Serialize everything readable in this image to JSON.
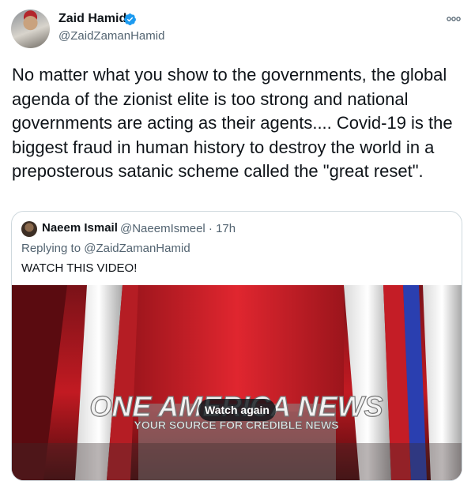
{
  "author": {
    "name": "Zaid Hamid",
    "handle": "@ZaidZamanHamid",
    "verified": true,
    "avatar_icon": "profile-photo"
  },
  "tweet": {
    "text": "No matter what you show to the governments, the global agenda of the zionist elite is too strong and national governments are acting as their agents.... Covid-19 is the biggest fraud in human history to destroy the world in a preposterous satanic scheme called the \"great reset\"."
  },
  "quoted": {
    "author_name": "Naeem Ismail",
    "meta": "@NaeemIsmeel · 17h",
    "reply_prefix": "Replying to ",
    "reply_to": "@ZaidZamanHamid",
    "text": "WATCH THIS VIDEO!",
    "video": {
      "logo_main": "ONE AMERICA NEWS",
      "logo_sub": "YOUR SOURCE FOR CREDIBLE NEWS",
      "overlay_button": "Watch again"
    }
  },
  "colors": {
    "verified_blue": "#1d9bf0",
    "secondary_text": "#536471",
    "border": "#cfd9de"
  }
}
